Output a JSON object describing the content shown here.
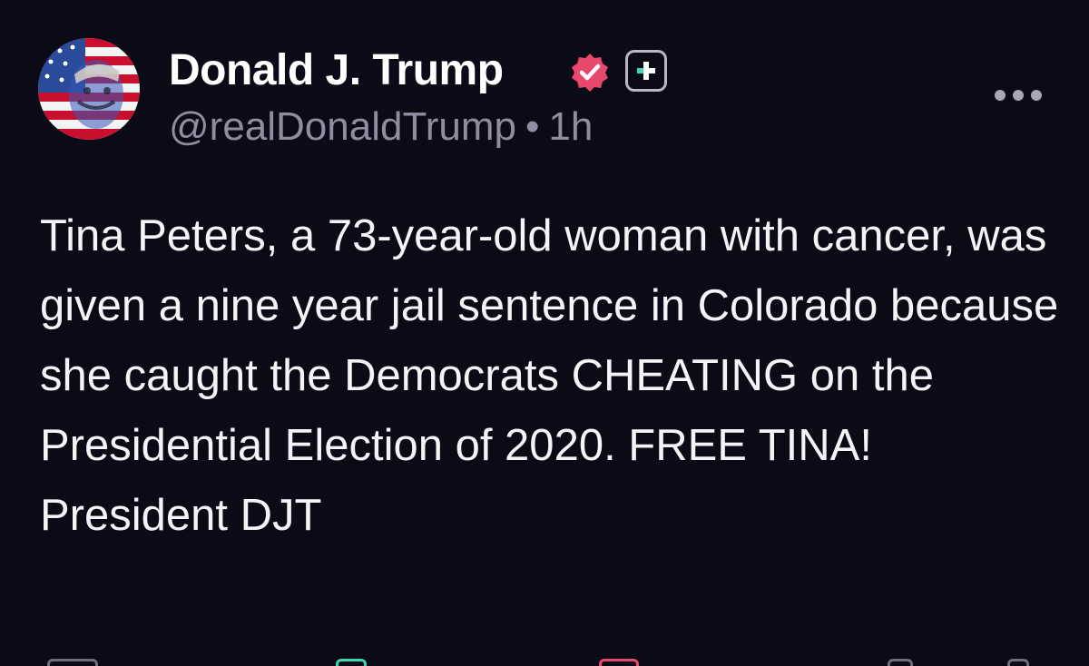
{
  "post": {
    "author": {
      "display_name": "Donald J. Trump",
      "handle": "@realDonaldTrump",
      "separator": "•",
      "time_ago": "1h",
      "avatar_icon": "flag-portrait-avatar",
      "verified_icon": "verified-badge-icon",
      "verified_color": "#e8486b",
      "plus_icon": "plus-badge-icon",
      "plus_color": "#3fd6b1"
    },
    "more_icon": "more-options-icon",
    "body": "Tina Peters, a 73-year-old woman with cancer, was given a nine year jail sentence in Colorado because she caught the Democrats CHEATING on the Presidential Election of 2020. FREE TINA! President DJT",
    "actions": [
      {
        "icon": "reply-icon",
        "color": "#6f6d80"
      },
      {
        "icon": "retruth-icon",
        "color": "#3fd6b1"
      },
      {
        "icon": "like-icon",
        "color": "#e8486b"
      },
      {
        "icon": "save-icon",
        "color": "#6f6d80"
      },
      {
        "icon": "share-icon",
        "color": "#6f6d80"
      }
    ]
  },
  "colors": {
    "background": "#0b0a17",
    "text_primary": "#f4f3f8",
    "text_secondary": "#8f8da0"
  }
}
